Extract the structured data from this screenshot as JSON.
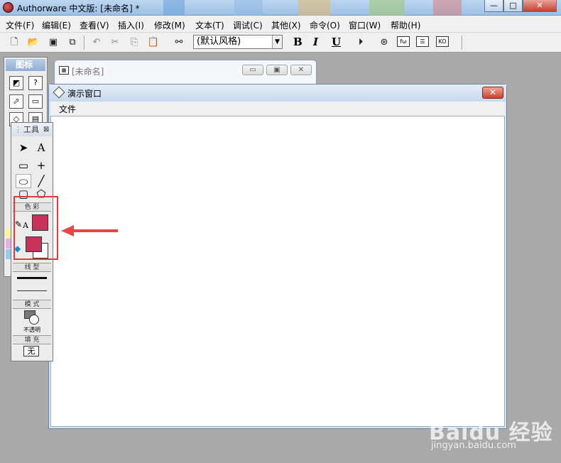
{
  "app": {
    "title": "Authorware 中文版: [未命名] *"
  },
  "title_buttons": {
    "minimize": "—",
    "maximize": "□",
    "close": "✕"
  },
  "menubar": {
    "items": [
      "文件(F)",
      "编辑(E)",
      "查看(V)",
      "插入(I)",
      "修改(M)",
      "文本(T)",
      "调试(C)",
      "其他(X)",
      "命令(O)",
      "窗口(W)",
      "帮助(H)"
    ]
  },
  "toolbar": {
    "style_select_value": "(默认风格)",
    "bold": "B",
    "italic": "I",
    "underline": "U",
    "icons": [
      "new-file",
      "open-folder",
      "save-all",
      "import",
      "undo",
      "cut",
      "copy",
      "paste",
      "find",
      "run-restart",
      "control-panel",
      "functions",
      "variables",
      "knowledge-objects"
    ]
  },
  "icon_palette": {
    "title": "图标"
  },
  "flowline_window": {
    "title": "[未命名]"
  },
  "presentation_window": {
    "title": "演示窗口",
    "menu": [
      "文件"
    ]
  },
  "tools_panel": {
    "title": "工具",
    "sections": {
      "color": "色 彩",
      "line": "线 型",
      "mode": "模 式",
      "fill": "填 充"
    },
    "mode_label": "不透明",
    "fill_value": "无",
    "text_tool": "A",
    "text_color": "A",
    "colors": {
      "foreground": "#c8325a",
      "fill_foreground": "#c8325a",
      "fill_background": "#ffffff",
      "highlight": "#e23a3a"
    }
  },
  "watermark": {
    "logo": "Baidu 经验",
    "url": "jingyan.baidu.com"
  }
}
